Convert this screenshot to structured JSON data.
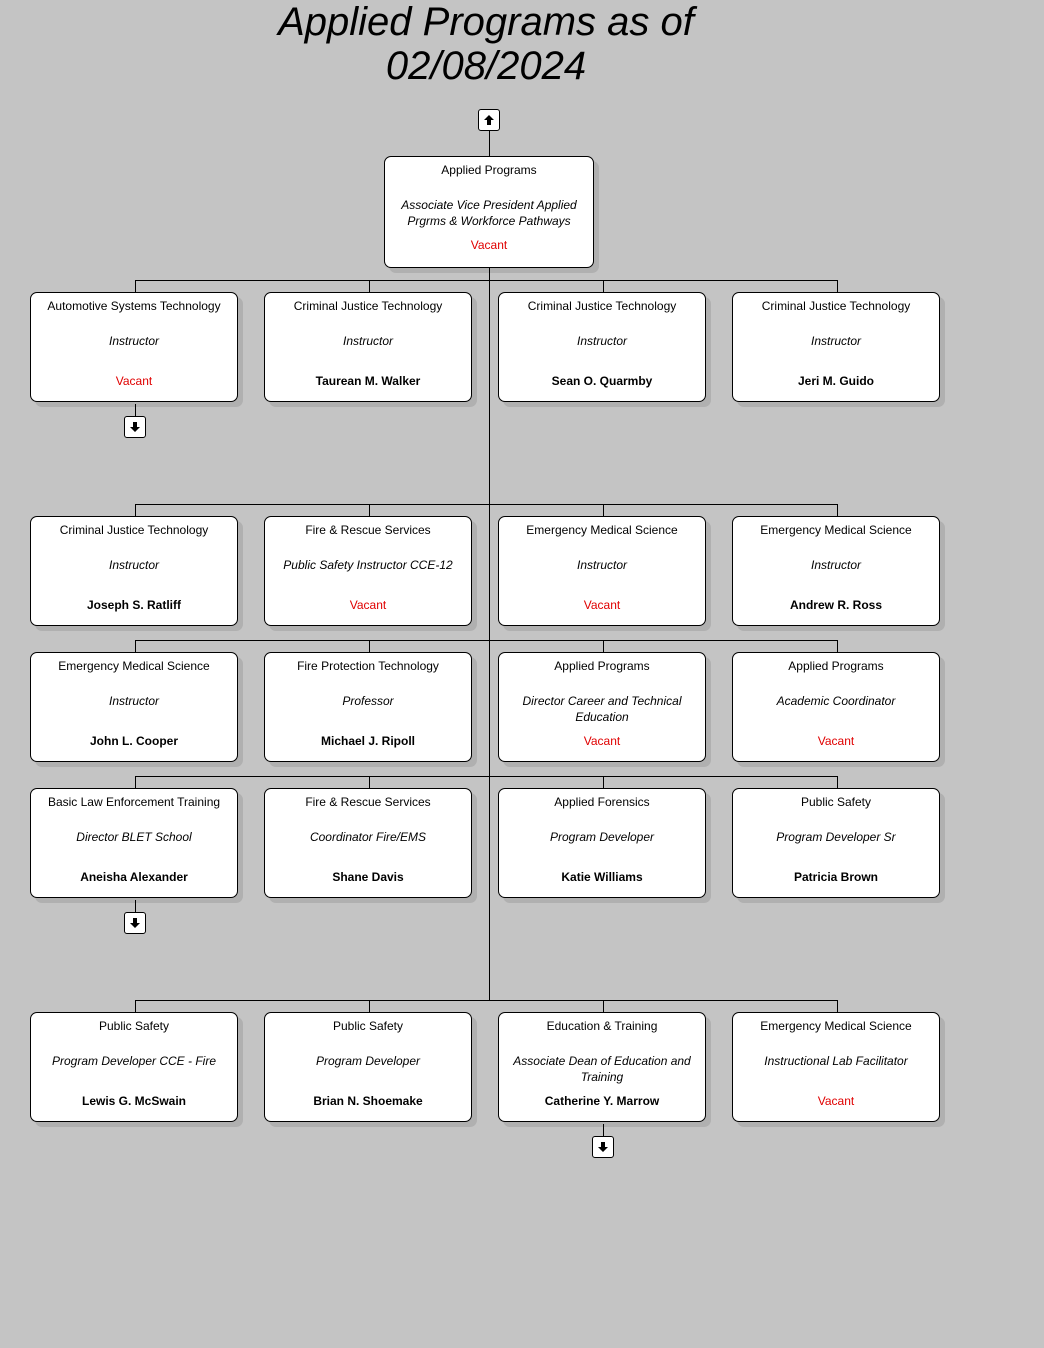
{
  "chart": {
    "title_line1": "Applied Programs as of",
    "title_line2": "02/08/2024",
    "vacant_color": "#e00000",
    "root": {
      "department": "Applied Programs",
      "role": "Associate Vice President Applied Prgrms & Workforce Pathways",
      "name": "Vacant",
      "vacant": true,
      "expand_up_icon": "arrow-up-icon"
    },
    "rows": [
      [
        {
          "department": "Automotive Systems Technology",
          "role": "Instructor",
          "name": "Vacant",
          "vacant": true,
          "has_children": true
        },
        {
          "department": "Criminal Justice Technology",
          "role": "Instructor",
          "name": "Taurean M. Walker",
          "vacant": false,
          "has_children": false
        },
        {
          "department": "Criminal Justice Technology",
          "role": "Instructor",
          "name": "Sean O. Quarmby",
          "vacant": false,
          "has_children": false
        },
        {
          "department": "Criminal Justice Technology",
          "role": "Instructor",
          "name": "Jeri M. Guido",
          "vacant": false,
          "has_children": false
        }
      ],
      [
        {
          "department": "Criminal Justice Technology",
          "role": "Instructor",
          "name": "Joseph S. Ratliff",
          "vacant": false,
          "has_children": false
        },
        {
          "department": "Fire & Rescue Services",
          "role": "Public Safety Instructor CCE-12",
          "name": "Vacant",
          "vacant": true,
          "has_children": false
        },
        {
          "department": "Emergency Medical Science",
          "role": "Instructor",
          "name": "Vacant",
          "vacant": true,
          "has_children": false
        },
        {
          "department": "Emergency Medical Science",
          "role": "Instructor",
          "name": "Andrew R. Ross",
          "vacant": false,
          "has_children": false
        }
      ],
      [
        {
          "department": "Emergency Medical Science",
          "role": "Instructor",
          "name": "John L. Cooper",
          "vacant": false,
          "has_children": false
        },
        {
          "department": "Fire Protection Technology",
          "role": "Professor",
          "name": "Michael J. Ripoll",
          "vacant": false,
          "has_children": false
        },
        {
          "department": "Applied Programs",
          "role": "Director Career and Technical Education",
          "name": "Vacant",
          "vacant": true,
          "has_children": false
        },
        {
          "department": "Applied Programs",
          "role": "Academic Coordinator",
          "name": "Vacant",
          "vacant": true,
          "has_children": false
        }
      ],
      [
        {
          "department": "Basic Law Enforcement Training",
          "role": "Director BLET School",
          "name": "Aneisha Alexander",
          "vacant": false,
          "has_children": true
        },
        {
          "department": "Fire & Rescue Services",
          "role": "Coordinator Fire/EMS",
          "name": "Shane Davis",
          "vacant": false,
          "has_children": false
        },
        {
          "department": "Applied Forensics",
          "role": "Program Developer",
          "name": "Katie Williams",
          "vacant": false,
          "has_children": false
        },
        {
          "department": "Public Safety",
          "role": "Program Developer Sr",
          "name": "Patricia Brown",
          "vacant": false,
          "has_children": false
        }
      ],
      [
        {
          "department": "Public Safety",
          "role": "Program Developer CCE - Fire",
          "name": "Lewis G. McSwain",
          "vacant": false,
          "has_children": false
        },
        {
          "department": "Public Safety",
          "role": "Program Developer",
          "name": "Brian N. Shoemake",
          "vacant": false,
          "has_children": false
        },
        {
          "department": "Education & Training",
          "role": "Associate Dean of Education and Training",
          "name": "Catherine Y. Marrow",
          "vacant": false,
          "has_children": true
        },
        {
          "department": "Emergency Medical Science",
          "role": "Instructional Lab Facilitator",
          "name": "Vacant",
          "vacant": true,
          "has_children": false
        }
      ]
    ]
  }
}
